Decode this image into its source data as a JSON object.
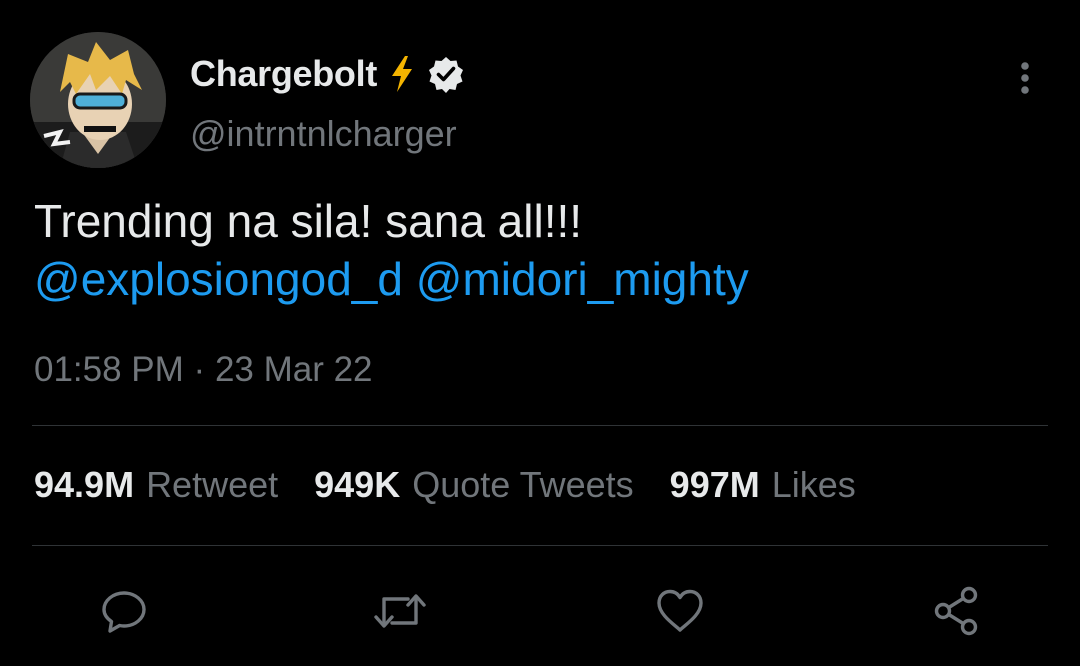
{
  "user": {
    "display_name": "Chargebolt",
    "handle": "@intrntnlcharger",
    "verified": true,
    "name_emoji": "lightning-bolt-icon"
  },
  "tweet": {
    "text_line1": "Trending na sila! sana all!!!",
    "mention1": "@explosiongod_d",
    "mention2": "@midori_mighty",
    "time": "01:58 PM",
    "separator": "·",
    "date": "23 Mar 22"
  },
  "stats": {
    "retweets_value": "94.9M",
    "retweets_label": "Retweet",
    "quotes_value": "949K",
    "quotes_label": "Quote Tweets",
    "likes_value": "997M",
    "likes_label": "Likes"
  },
  "actions": [
    "reply-icon",
    "retweet-icon",
    "like-icon",
    "share-icon"
  ],
  "colors": {
    "background": "#000000",
    "text": "#e7e9ea",
    "muted": "#71767b",
    "link": "#1d9bf0",
    "divider": "#2f3336",
    "bolt": "#f4b400"
  }
}
